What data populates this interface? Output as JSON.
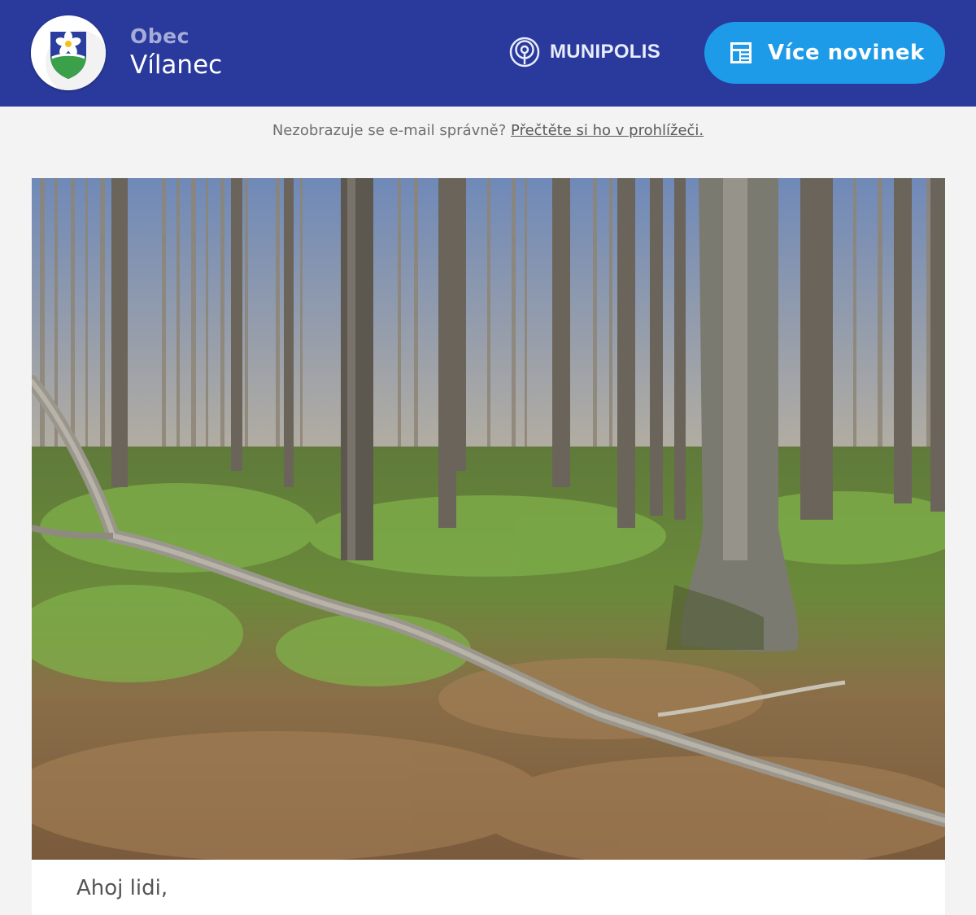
{
  "header": {
    "town_kind": "Obec",
    "town_name": "Vílanec",
    "logo_icon": "coat-of-arms-flower-icon",
    "brand": "MUNIPOLIS",
    "brand_icon": "broadcast-icon",
    "more_button_label": "Více novinek",
    "more_button_icon": "newspaper-icon",
    "colors": {
      "header_bg": "#2a3a9c",
      "button_bg": "#1e9be8"
    }
  },
  "preheader": {
    "text": "Nezobrazuje se e-mail správně?",
    "link": "Přečtěte si ho v prohlížeči."
  },
  "hero_image": {
    "description_icon": "forest-photo"
  },
  "body": {
    "greeting": "Ahoj lidi,"
  }
}
